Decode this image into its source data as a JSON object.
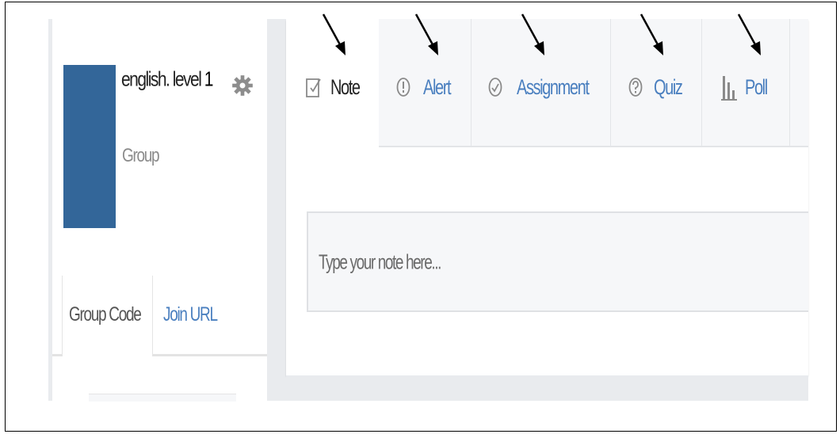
{
  "group": {
    "name_prefix": "english. level ",
    "name_suffix": "1",
    "type": "Group",
    "avatar_color": "#336699",
    "settings_icon": "gear-icon"
  },
  "group_tabs": {
    "items": [
      {
        "label": "Group Code",
        "active": true
      },
      {
        "label": "Join URL",
        "active": false
      }
    ]
  },
  "composer": {
    "tools": [
      {
        "label": "Note",
        "icon": "note-icon",
        "active": true
      },
      {
        "label": "Alert",
        "icon": "alert-icon",
        "active": false
      },
      {
        "label": "Assignment",
        "icon": "assignment-icon",
        "active": false
      },
      {
        "label": "Quiz",
        "icon": "quiz-icon",
        "active": false
      },
      {
        "label": "Poll",
        "icon": "poll-icon",
        "active": false
      }
    ],
    "placeholder": "Type your note here...",
    "annotation_arrows": 5
  },
  "colors": {
    "link": "#4a7fbf",
    "panel_bg": "#f6f7f9",
    "page_bg": "#e9ebee"
  }
}
